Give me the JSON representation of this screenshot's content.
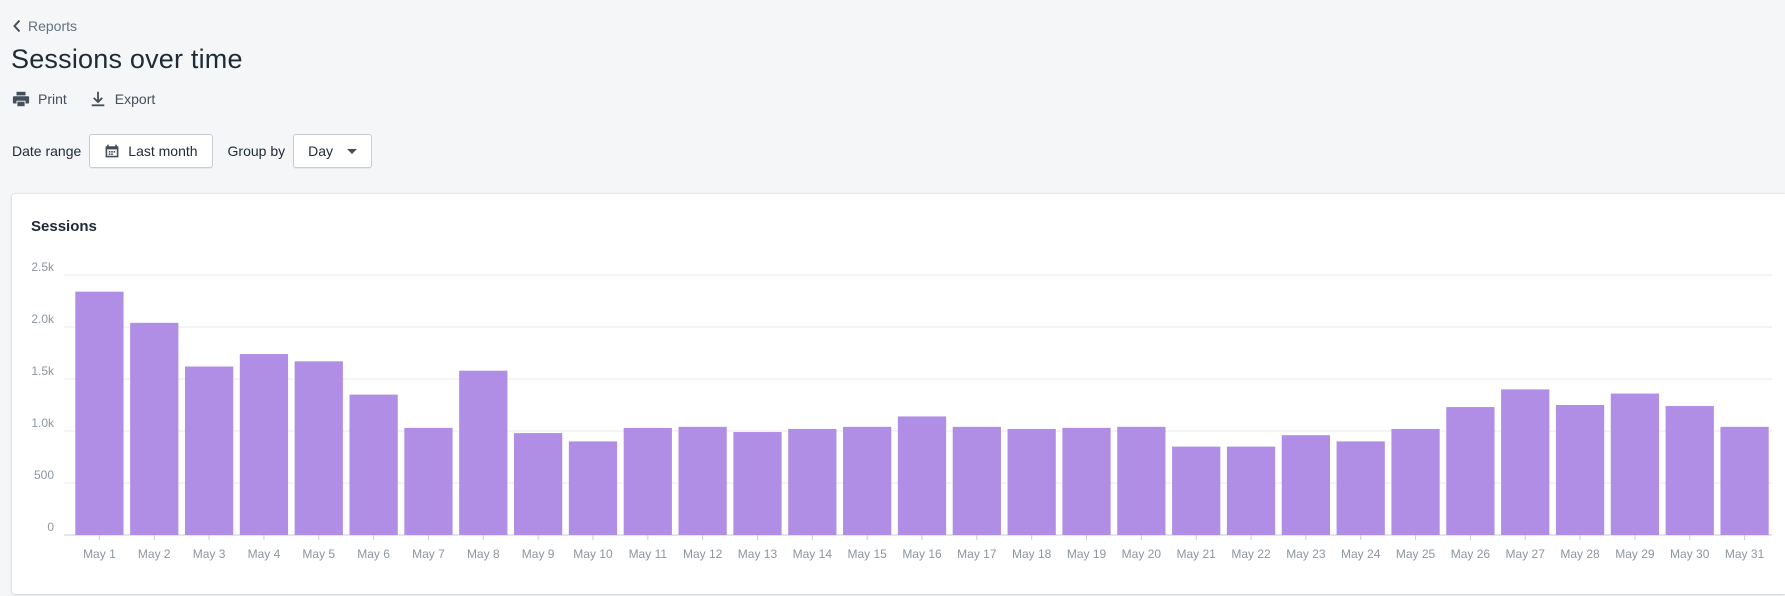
{
  "breadcrumb": {
    "label": "Reports"
  },
  "page": {
    "title": "Sessions over time"
  },
  "actions": {
    "print_label": "Print",
    "export_label": "Export"
  },
  "filters": {
    "date_range_label": "Date range",
    "date_range_value": "Last month",
    "group_by_label": "Group by",
    "group_by_value": "Day"
  },
  "colors": {
    "bar": "#b08ee6",
    "gridline": "#e6e9ec",
    "axis": "#c4cdd5",
    "page_bg": "#f4f6f8"
  },
  "icons": {
    "back": "chevron-left-icon",
    "print": "printer-icon",
    "export": "download-icon",
    "calendar": "calendar-icon",
    "dropdown": "caret-down-icon"
  },
  "chart_data": {
    "type": "bar",
    "title": "Sessions",
    "xlabel": "",
    "ylabel": "",
    "ylim": [
      0,
      2500
    ],
    "yticks": [
      0,
      500,
      1000,
      1500,
      2000,
      2500
    ],
    "ytick_labels": [
      "0",
      "500",
      "1.0k",
      "1.5k",
      "2.0k",
      "2.5k"
    ],
    "grid": true,
    "categories": [
      "May 1",
      "May 2",
      "May 3",
      "May 4",
      "May 5",
      "May 6",
      "May 7",
      "May 8",
      "May 9",
      "May 10",
      "May 11",
      "May 12",
      "May 13",
      "May 14",
      "May 15",
      "May 16",
      "May 17",
      "May 18",
      "May 19",
      "May 20",
      "May 21",
      "May 22",
      "May 23",
      "May 24",
      "May 25",
      "May 26",
      "May 27",
      "May 28",
      "May 29",
      "May 30",
      "May 31"
    ],
    "values": [
      2340,
      2040,
      1620,
      1740,
      1670,
      1350,
      1030,
      1580,
      980,
      900,
      1030,
      1040,
      990,
      1020,
      1040,
      1140,
      1040,
      1020,
      1030,
      1040,
      850,
      850,
      960,
      900,
      1020,
      1230,
      1400,
      1250,
      1360,
      1240,
      1040
    ]
  }
}
